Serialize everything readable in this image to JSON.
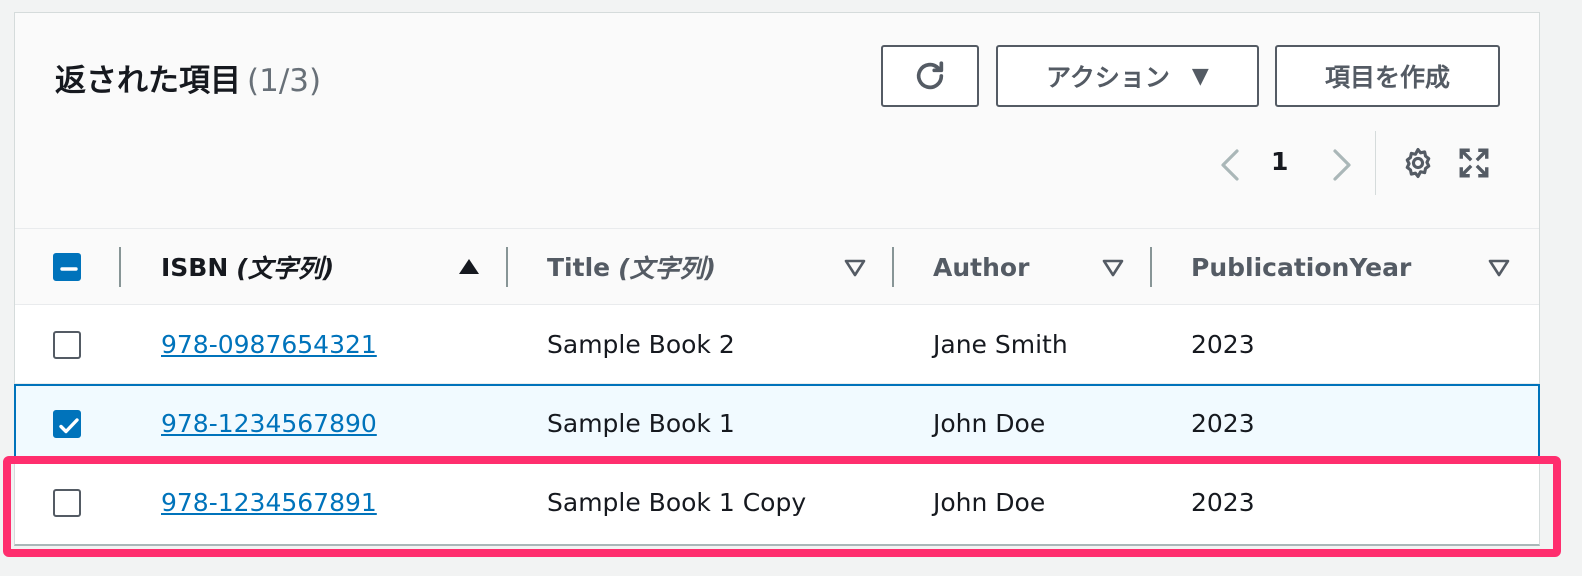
{
  "header": {
    "title": "返された項目",
    "count": "(1/3)",
    "refresh_icon": "refresh-icon",
    "actions_label": "アクション",
    "create_label": "項目を作成"
  },
  "pagination": {
    "current_page": "1",
    "prev_icon": "chevron-left-icon",
    "next_icon": "chevron-right-icon",
    "settings_icon": "gear-icon",
    "fullscreen_icon": "fullscreen-icon"
  },
  "columns": [
    {
      "name": "ISBN",
      "type": "(文字列)",
      "sort": "ascending"
    },
    {
      "name": "Title",
      "type": "(文字列)",
      "sort": "none"
    },
    {
      "name": "Author",
      "type": "",
      "sort": "none"
    },
    {
      "name": "PublicationYear",
      "type": "",
      "sort": "none"
    }
  ],
  "rows": [
    {
      "isbn": "978-0987654321",
      "title": "Sample Book 2",
      "author": "Jane Smith",
      "year": "2023",
      "checked": false
    },
    {
      "isbn": "978-1234567890",
      "title": "Sample Book 1",
      "author": "John Doe",
      "year": "2023",
      "checked": true
    },
    {
      "isbn": "978-1234567891",
      "title": "Sample Book 1 Copy",
      "author": "John Doe",
      "year": "2023",
      "checked": false
    }
  ],
  "colors": {
    "accent": "#0073bb",
    "highlight": "#ff2e6e",
    "selected_row_bg": "#f1faff"
  }
}
